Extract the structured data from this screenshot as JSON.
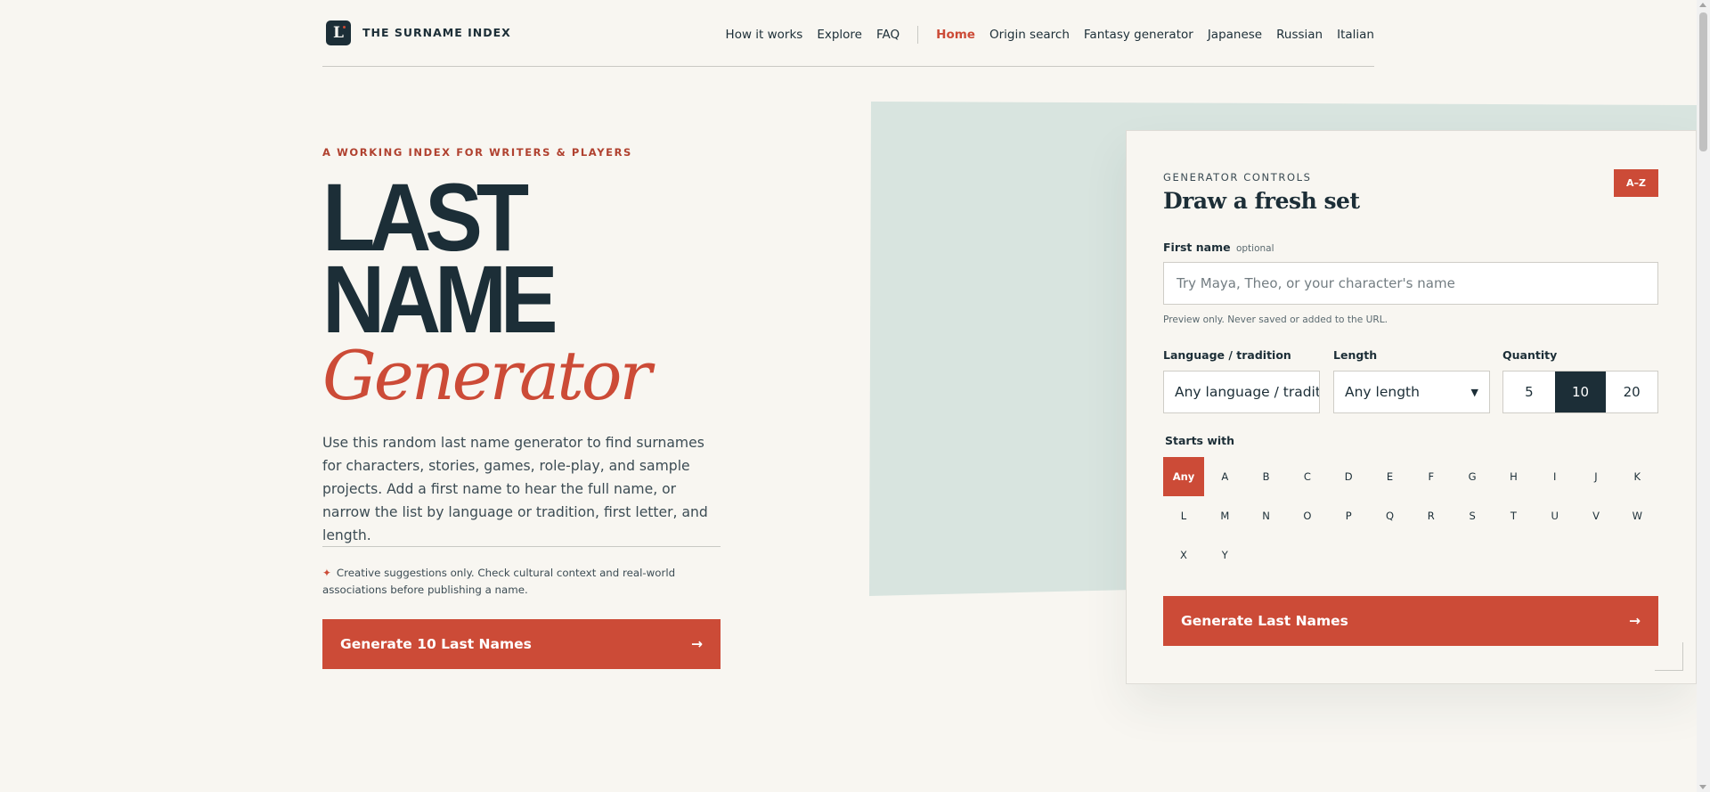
{
  "header": {
    "brand": "THE SURNAME INDEX",
    "logo_letter": "L",
    "nav_primary": [
      "How it works",
      "Explore",
      "FAQ"
    ],
    "nav_secondary": [
      {
        "label": "Home",
        "active": true
      },
      {
        "label": "Origin search",
        "active": false
      },
      {
        "label": "Fantasy generator",
        "active": false
      },
      {
        "label": "Japanese",
        "active": false
      },
      {
        "label": "Russian",
        "active": false
      },
      {
        "label": "Italian",
        "active": false
      }
    ]
  },
  "hero": {
    "eyebrow": "A WORKING INDEX FOR WRITERS & PLAYERS",
    "title_line1": "LAST",
    "title_line2": "NAME",
    "title_line3": "Generator",
    "lead": "Use this random last name generator to find surnames for characters, stories, games, role-play, and sample projects. Add a first name to hear the full name, or narrow the list by language or tradition, first letter, and length.",
    "note_icon": "✦",
    "note": "Creative suggestions only. Check cultural context and real-world associations before publishing a name.",
    "cta_label": "Generate 10 Last Names",
    "cta_arrow": "→"
  },
  "panel": {
    "eyebrow": "GENERATOR CONTROLS",
    "title": "Draw a fresh set",
    "sort_button": "A–Z",
    "first_name_label": "First name",
    "first_name_optional": "optional",
    "first_name_placeholder": "Try Maya, Theo, or your character's name",
    "first_name_value": "",
    "first_name_hint": "Preview only. Never saved or added to the URL.",
    "language_label": "Language / tradition",
    "language_value": "Any language / tradition",
    "length_label": "Length",
    "length_value": "Any length",
    "quantity_label": "Quantity",
    "quantity_options": [
      "5",
      "10",
      "20"
    ],
    "quantity_selected": "10",
    "starts_with_label": "Starts with",
    "letters": [
      "Any",
      "A",
      "B",
      "C",
      "D",
      "E",
      "F",
      "G",
      "H",
      "I",
      "J",
      "K",
      "L",
      "M",
      "N",
      "O",
      "P",
      "Q",
      "R",
      "S",
      "T",
      "U",
      "V",
      "W",
      "X",
      "Y"
    ],
    "letter_selected": "Any",
    "generate_label": "Generate Last Names",
    "generate_arrow": "→"
  },
  "colors": {
    "accent": "#cc4b37",
    "ink": "#1c2e37",
    "background": "#f8f6f1",
    "deco": "#d8e4df"
  }
}
